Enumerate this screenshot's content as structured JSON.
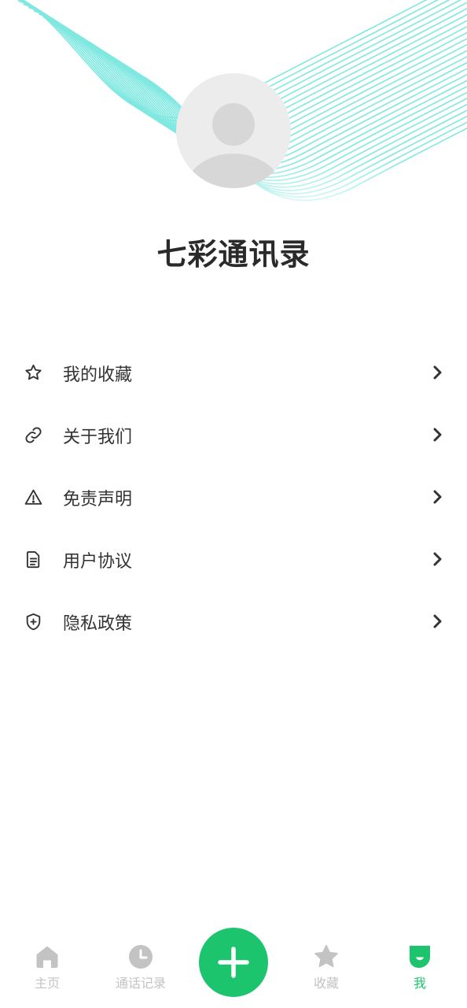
{
  "profile": {
    "app_title": "七彩通讯录"
  },
  "menu": {
    "items": [
      {
        "label": "我的收藏",
        "icon": "star-outline-icon"
      },
      {
        "label": "关于我们",
        "icon": "link-icon"
      },
      {
        "label": "免责声明",
        "icon": "warning-icon"
      },
      {
        "label": "用户协议",
        "icon": "document-icon"
      },
      {
        "label": "隐私政策",
        "icon": "shield-icon"
      }
    ]
  },
  "tabbar": {
    "tabs": [
      {
        "label": "主页",
        "icon": "home-icon",
        "active": false
      },
      {
        "label": "通话记录",
        "icon": "clock-icon",
        "active": false
      },
      {
        "label": "收藏",
        "icon": "star-icon",
        "active": false
      },
      {
        "label": "我",
        "icon": "profile-icon",
        "active": true
      }
    ],
    "fab_icon": "plus-icon"
  },
  "colors": {
    "accent": "#1cc46e",
    "wave_lines": "#7fe8e0",
    "inactive_tab": "#c3c3c3",
    "text": "#333333"
  }
}
